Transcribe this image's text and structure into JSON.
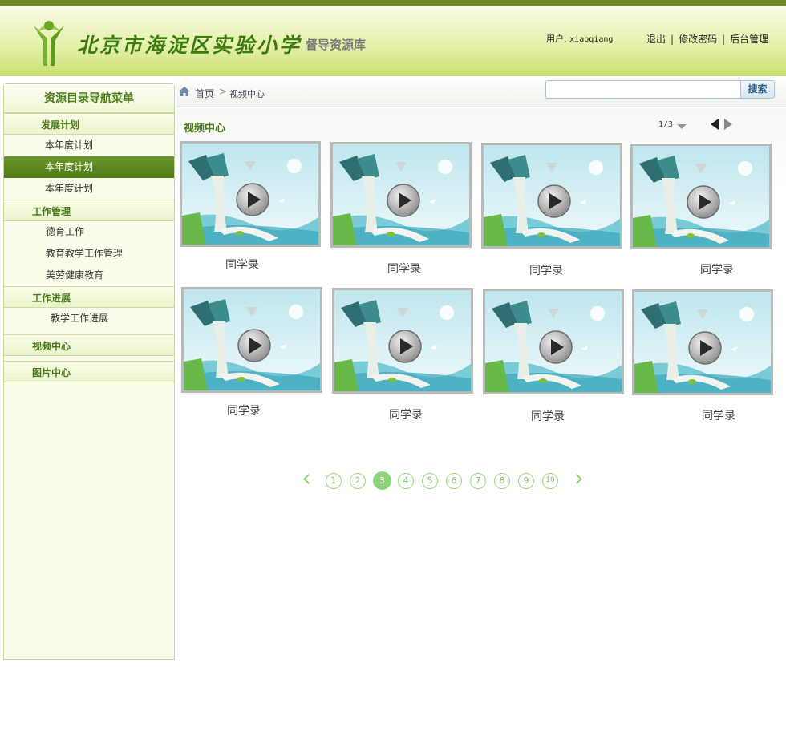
{
  "header": {
    "school_name": "北京市海淀区实验小学",
    "subtitle": "督导资源库",
    "user_label": "用户:",
    "username": "xiaoqiang",
    "links": [
      "退出",
      "修改密码",
      "后台管理"
    ],
    "link_separator": "|"
  },
  "sidebar": {
    "title": "资源目录导航菜单",
    "sections": [
      {
        "label": "发展计划",
        "items": [
          {
            "label": "本年度计划",
            "active": false
          },
          {
            "label": "本年度计划",
            "active": true
          },
          {
            "label": "本年度计划",
            "active": false
          }
        ]
      },
      {
        "label": "工作管理",
        "items": [
          {
            "label": "德育工作",
            "active": false
          },
          {
            "label": "教育教学工作管理",
            "active": false
          },
          {
            "label": "美劳健康教育",
            "active": false
          }
        ]
      },
      {
        "label": "工作进展",
        "items": [
          {
            "label": "教学工作进展",
            "active": false
          }
        ]
      },
      {
        "label": "视频中心",
        "items": []
      },
      {
        "label": "图片中心",
        "items": []
      }
    ]
  },
  "breadcrumb": {
    "home": "首页",
    "separator": ">",
    "current": "视频中心"
  },
  "search": {
    "placeholder": "",
    "button_label": "搜索"
  },
  "content": {
    "section_title": "视频中心",
    "page_indicator": "1/3",
    "videos": [
      {
        "title": "同学录"
      },
      {
        "title": "同学录"
      },
      {
        "title": "同学录"
      },
      {
        "title": "同学录"
      },
      {
        "title": "同学录"
      },
      {
        "title": "同学录"
      },
      {
        "title": "同学录"
      },
      {
        "title": "同学录"
      }
    ]
  },
  "pagination": {
    "pages": [
      "1",
      "2",
      "3",
      "4",
      "5",
      "6",
      "7",
      "8",
      "9",
      "10"
    ],
    "current": "3"
  },
  "colors": {
    "brand_green": "#4b7a18",
    "active_item": "#5a8420",
    "pager_green": "#8dd47a"
  }
}
